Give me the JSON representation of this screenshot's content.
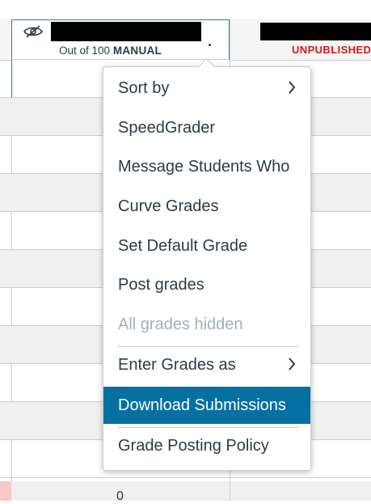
{
  "header": {
    "points_text": "Out of 100",
    "grading_type": "MANUAL",
    "other_column_status": "UNPUBLISHED"
  },
  "grid": {
    "bottom_cell_value": "0"
  },
  "menu": {
    "items": [
      {
        "label": "Sort by",
        "has_submenu": true
      },
      {
        "label": "SpeedGrader"
      },
      {
        "label": "Message Students Who"
      },
      {
        "label": "Curve Grades"
      },
      {
        "label": "Set Default Grade"
      },
      {
        "label": "Post grades"
      },
      {
        "label": "All grades hidden",
        "disabled": true
      },
      {
        "label": "Enter Grades as",
        "has_submenu": true
      },
      {
        "label": "Download Submissions",
        "selected": true
      },
      {
        "label": "Grade Posting Policy"
      }
    ]
  },
  "colors": {
    "accent": "#0770a3",
    "focus_border": "#2b7abc",
    "unpublished": "#d01a19",
    "disabled_text": "#a5afb5"
  }
}
